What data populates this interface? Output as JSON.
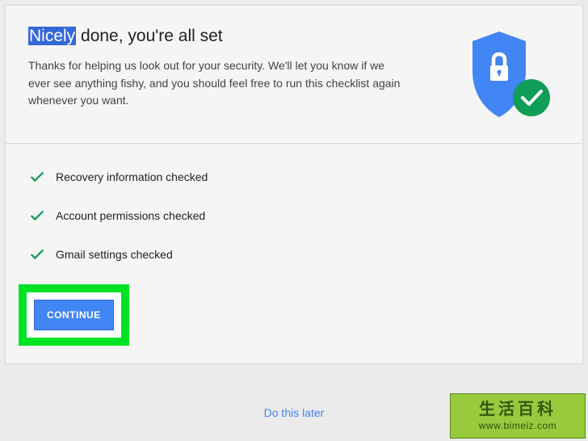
{
  "header": {
    "title_highlight": "Nicely",
    "title_rest": " done, you're all set",
    "description": "Thanks for helping us look out for your security. We'll let you know if we ever see anything fishy, and you should feel free to run this checklist again whenever you want."
  },
  "checklist": {
    "items": [
      {
        "label": "Recovery information checked"
      },
      {
        "label": "Account permissions checked"
      },
      {
        "label": "Gmail settings checked"
      }
    ]
  },
  "actions": {
    "continue_label": "CONTINUE",
    "later_label": "Do this later"
  },
  "watermark": {
    "title": "生活百科",
    "url": "www.bimeiz.com"
  },
  "colors": {
    "accent_blue": "#4285f4",
    "check_green": "#0f9d58",
    "highlight_green": "#00e325",
    "badge_green": "#0f9d58"
  }
}
